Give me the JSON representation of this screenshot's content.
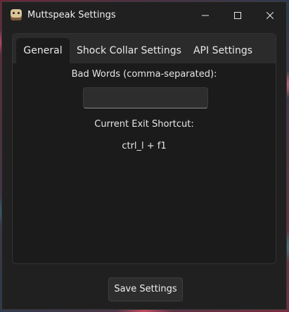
{
  "window": {
    "title": "Muttspeak Settings",
    "app_icon": "dog-face-icon",
    "controls": [
      "minimize-icon",
      "maximize-icon",
      "close-icon"
    ]
  },
  "tabs": [
    {
      "label": "General",
      "active": true
    },
    {
      "label": "Shock Collar Settings",
      "active": false
    },
    {
      "label": "API Settings",
      "active": false
    }
  ],
  "general": {
    "bad_words_label": "Bad Words (comma-separated):",
    "bad_words_value": "",
    "exit_shortcut_label": "Current Exit Shortcut:",
    "exit_shortcut_value": "ctrl_l + f1"
  },
  "footer": {
    "save_label": "Save Settings"
  },
  "colors": {
    "window_bg": "#202020",
    "panel_bg": "#1b1b1b",
    "tabbar_bg": "#2b2b2b",
    "text": "#e6e6e6"
  }
}
